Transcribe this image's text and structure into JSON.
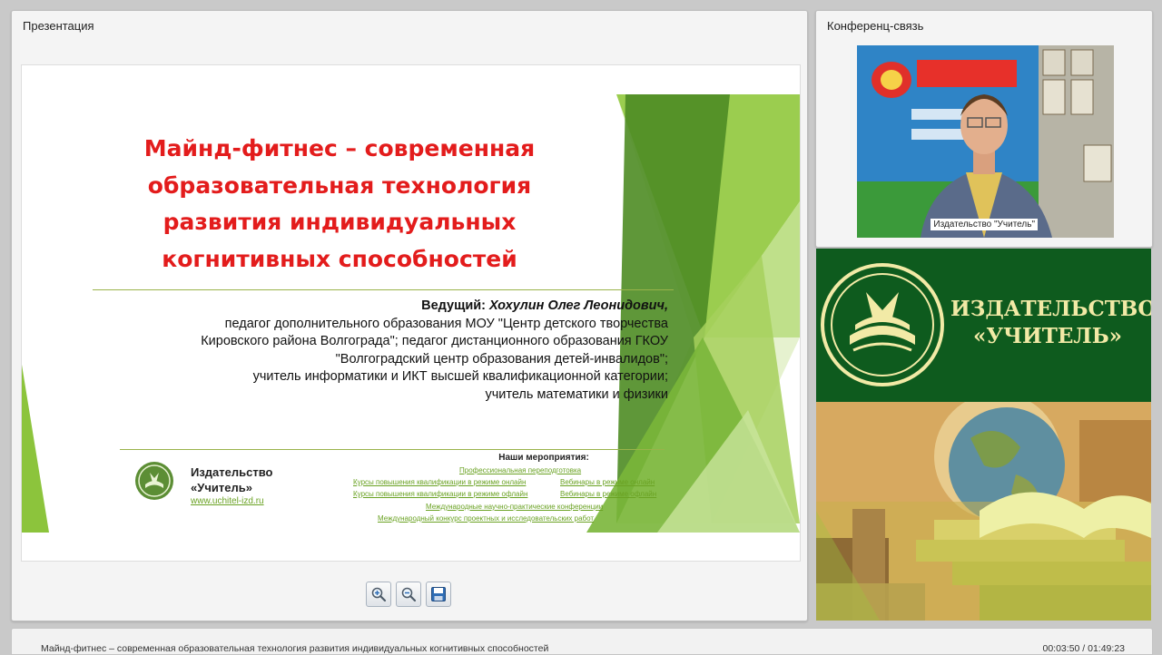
{
  "presentation_panel": {
    "title": "Презентация"
  },
  "slide": {
    "title_lines": [
      "Майнд-фитнес – современная",
      "образовательная технология",
      "развития индивидуальных",
      "когнитивных способностей"
    ],
    "presenter_label": "Ведущий:",
    "presenter_name": "Хохулин Олег Леонидович,",
    "presenter_lines": [
      "педагог дополнительного образования МОУ \"Центр детского творчества",
      "Кировского района Волгограда\"; педагог дистанционного образования ГКОУ",
      "\"Волгоградский центр образования детей-инвалидов\";",
      "учитель информатики и ИКТ высшей квалификационной категории;",
      "учитель математики и физики"
    ],
    "publisher_name_1": "Издательство",
    "publisher_name_2": "«Учитель»",
    "publisher_url": "www.uchitel-izd.ru",
    "events_header": "Наши мероприятия:",
    "events": [
      "Профессиональная переподготовка",
      "Курсы повышения квалификации в режиме онлайн",
      "Вебинары в режиме онлайн",
      "Курсы повышения квалификации в режиме офлайн",
      "Вебинары в режиме офлайн",
      "Международные научно-практические конференции",
      "Международный конкурс проектных и исследовательских работ"
    ]
  },
  "toolbar": {
    "zoom_in_icon": "zoom-in-icon",
    "zoom_out_icon": "zoom-out-icon",
    "save_icon": "save-icon"
  },
  "conference_panel": {
    "title": "Конференц-связь",
    "video_label": "Издательство \"Учитель\""
  },
  "banner": {
    "line1": "ИЗДАТЕЛЬСТВО",
    "line2": "«УЧИТЕЛЬ»"
  },
  "footer": {
    "title": "Майнд-фитнес – современная образовательная технология развития индивидуальных когнитивных способностей",
    "time": "00:03:50 / 01:49:23"
  },
  "colors": {
    "title_red": "#e31c1c",
    "accent_green": "#7cb32a",
    "banner_green": "#0e5b1e",
    "banner_text": "#f2eaa6"
  }
}
